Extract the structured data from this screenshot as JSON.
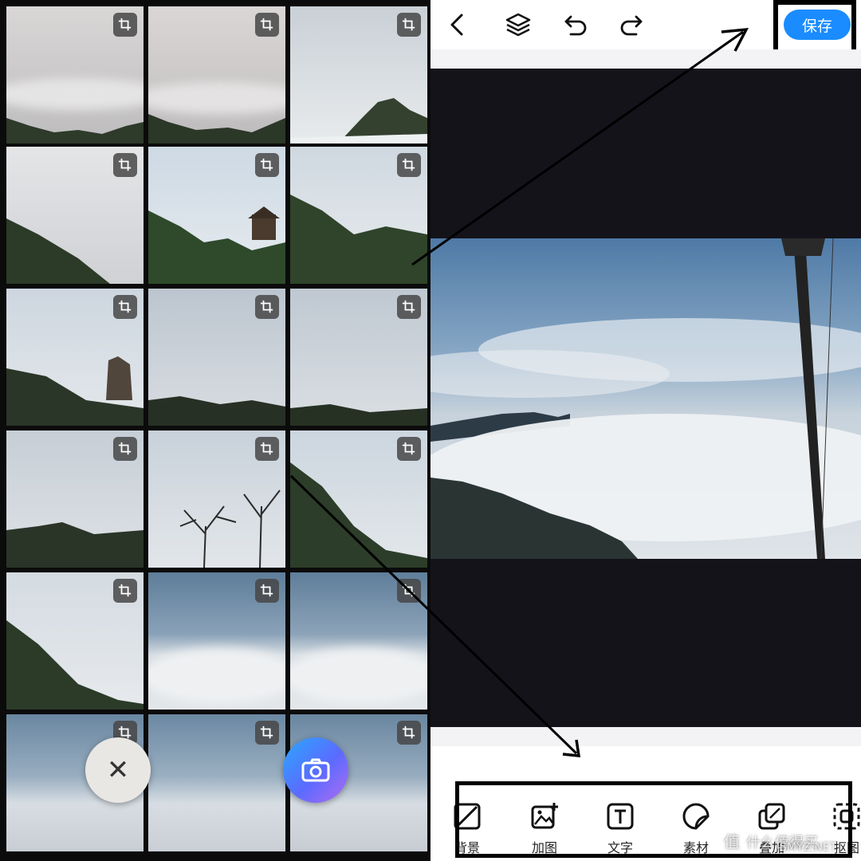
{
  "editor": {
    "save_label": "保存"
  },
  "tools": [
    {
      "label": "背景",
      "icon": "background-icon"
    },
    {
      "label": "加图",
      "icon": "add-image-icon"
    },
    {
      "label": "文字",
      "icon": "text-icon"
    },
    {
      "label": "素材",
      "icon": "sticker-icon"
    },
    {
      "label": "叠加",
      "icon": "overlay-icon"
    },
    {
      "label": "抠图",
      "icon": "cutout-icon"
    }
  ],
  "watermark": {
    "glyph": "值",
    "text": "什么值得买",
    "site": "SMYZ.NET"
  },
  "colors": {
    "accent": "#1a8cff",
    "canvas": "#14131a"
  }
}
